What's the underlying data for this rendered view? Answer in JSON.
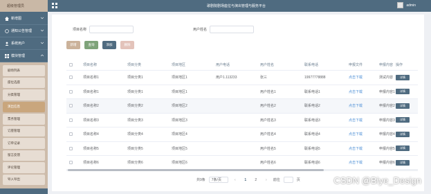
{
  "header": {
    "brand": "超级管理员",
    "title": "歌剧院剧场座位与演出管理与服务平台",
    "user_name": "admin"
  },
  "sidebar": {
    "items": [
      {
        "label": "新增图",
        "icon": "home-icon"
      },
      {
        "label": "通知公告管理",
        "icon": "bell-icon"
      },
      {
        "label": "系统用户",
        "icon": "user-icon"
      },
      {
        "label": "模块管理",
        "icon": "grid-icon"
      }
    ],
    "subitems": [
      "剧场列表",
      "座位选座",
      "分类管理",
      "演出信息",
      "票务管理",
      "订座管理",
      "订单记录",
      "留言反馈",
      "评论管理",
      "导入导出"
    ],
    "active_sub": 3
  },
  "search": {
    "field1_label": "项目名称",
    "field2_label": "用户姓名"
  },
  "buttons": {
    "b1": {
      "label": "新增",
      "color": "#cbb29a"
    },
    "b2": {
      "label": "查询",
      "color": "#7fa37a"
    },
    "b3": {
      "label": "添加",
      "color": "#4f6b80"
    },
    "b4": {
      "label": "删除",
      "color": "#e3c3ba"
    }
  },
  "table": {
    "columns": [
      "项目名称",
      "项目分类",
      "项目地区",
      "用户电话",
      "用户姓名",
      "联系电话",
      "申报文件",
      "申报内容",
      "操作"
    ],
    "rows": [
      [
        "项目名称1",
        "项目分类1",
        "项目地区1",
        "用户1.113233",
        "张三",
        "19977778888",
        "点击下载",
        "测试内容",
        "详情"
      ],
      [
        "项目名称1",
        "项目分类1",
        "项目地区1",
        "",
        "用户姓名1",
        "联系电话1",
        "点击下载",
        "申报内容1",
        "详情"
      ],
      [
        "项目名称2",
        "项目分类2",
        "项目地区2",
        "",
        "用户姓名2",
        "联系电话2",
        "点击下载",
        "申报内容2",
        "详情"
      ],
      [
        "项目名称3",
        "项目分类3",
        "项目地区3",
        "",
        "用户姓名3",
        "联系电话3",
        "点击下载",
        "申报内容3",
        "详情"
      ],
      [
        "项目名称4",
        "项目分类4",
        "项目地区4",
        "",
        "用户姓名4",
        "联系电话4",
        "点击下载",
        "申报内容4",
        "详情"
      ],
      [
        "项目名称5",
        "项目分类5",
        "项目地区5",
        "",
        "用户姓名5",
        "联系电话5",
        "点击下载",
        "申报内容5",
        "详情"
      ],
      [
        "项目名称6",
        "项目分类6",
        "项目地区6",
        "",
        "用户姓名6",
        "联系电话6",
        "点击下载",
        "申报内容6",
        "详情"
      ]
    ],
    "highlight_row": 2
  },
  "pager": {
    "total": "共9条",
    "size": "7条/页",
    "pages": [
      "1",
      "2"
    ],
    "current": "1",
    "goto_label": "前往",
    "page_suffix": "页"
  },
  "watermark": "CSDN @Biye_Design"
}
